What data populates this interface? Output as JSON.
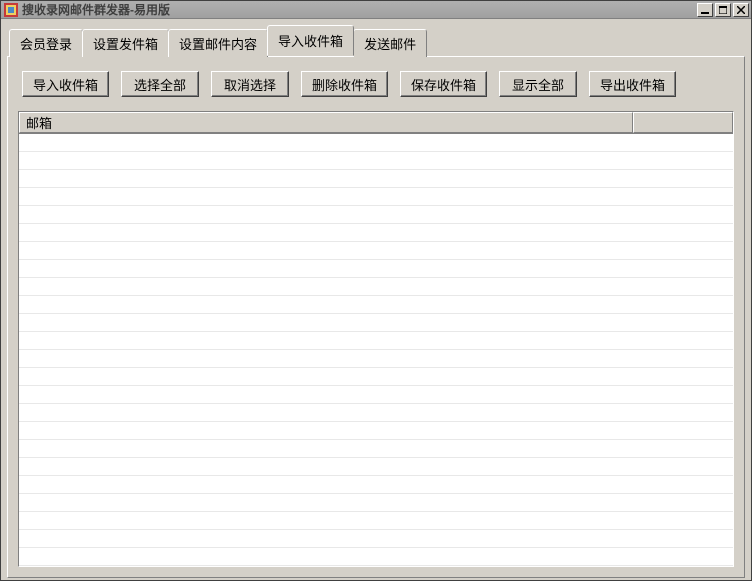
{
  "window": {
    "title": "搜收录网邮件群发器-易用版"
  },
  "tabs": [
    {
      "label": "会员登录",
      "active": false
    },
    {
      "label": "设置发件箱",
      "active": false
    },
    {
      "label": "设置邮件内容",
      "active": false
    },
    {
      "label": "导入收件箱",
      "active": true
    },
    {
      "label": "发送邮件",
      "active": false
    }
  ],
  "toolbar": {
    "import": "导入收件箱",
    "selectAll": "选择全部",
    "deselect": "取消选择",
    "delete": "删除收件箱",
    "save": "保存收件箱",
    "showAll": "显示全部",
    "export": "导出收件箱"
  },
  "list": {
    "columns": [
      {
        "label": "邮箱"
      },
      {
        "label": ""
      }
    ],
    "rows": []
  }
}
